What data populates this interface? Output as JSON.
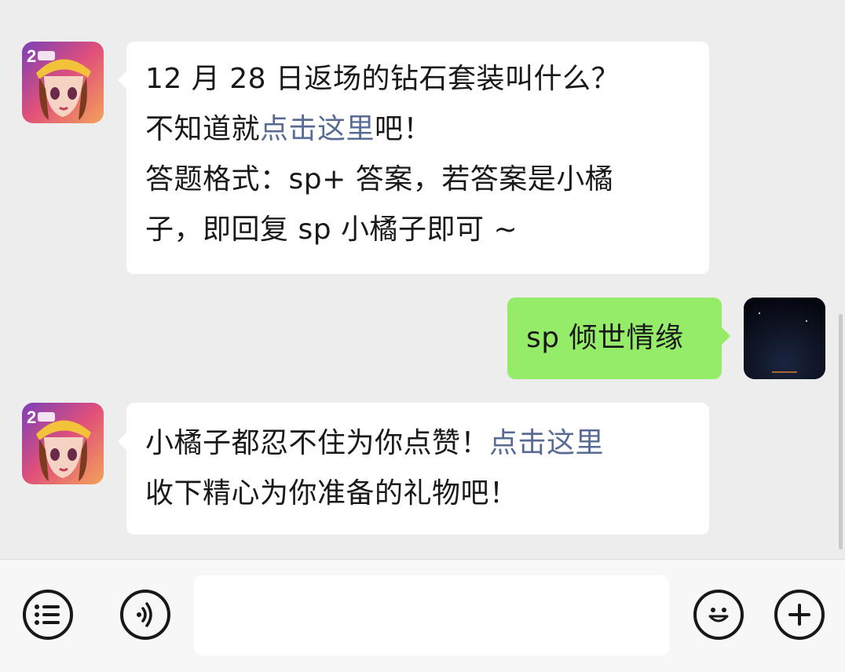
{
  "messages": [
    {
      "side": "in",
      "avatar_icon": "game-avatar-icon",
      "lines": [
        {
          "text": "12 月 28 日返场的钻石套装叫什么？"
        },
        {
          "pre": "不知道就",
          "link": "点击这里",
          "post": "吧！"
        },
        {
          "text": "答题格式：sp+ 答案，若答案是小橘"
        },
        {
          "text": "子，即回复 sp 小橘子即可 ~"
        }
      ]
    },
    {
      "side": "out",
      "avatar_icon": "moon-avatar-icon",
      "text": "sp 倾世情缘"
    },
    {
      "side": "in",
      "avatar_icon": "game-avatar-icon",
      "lines": [
        {
          "pre": "小橘子都忍不住为你点赞！",
          "link": "点击这里",
          "post": ""
        },
        {
          "text": "收下精心为你准备的礼物吧！"
        }
      ]
    }
  ],
  "input_bar": {
    "menu_icon": "list-menu-icon",
    "voice_icon": "voice-icon",
    "input_value": "",
    "emoji_icon": "emoji-icon",
    "plus_icon": "plus-icon"
  },
  "colors": {
    "background": "#ededed",
    "bubble_in": "#ffffff",
    "bubble_out": "#95ec69",
    "link": "#576b95"
  }
}
